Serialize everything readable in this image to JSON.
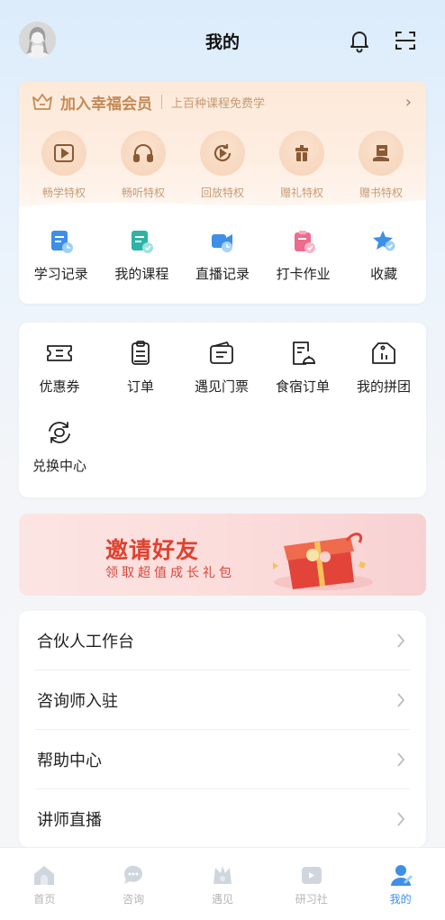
{
  "header": {
    "title": "我的",
    "bell_icon": "bell-icon",
    "scan_icon": "scan-icon"
  },
  "vip": {
    "title": "加入幸福会员",
    "subtitle": "上百种课程免费学",
    "arrow": "›",
    "perks": [
      {
        "label": "畅学特权",
        "icon": "play-icon"
      },
      {
        "label": "畅听特权",
        "icon": "headphones-icon"
      },
      {
        "label": "回放特权",
        "icon": "replay-icon"
      },
      {
        "label": "赠礼特权",
        "icon": "gift-icon"
      },
      {
        "label": "赠书特权",
        "icon": "book-icon"
      }
    ],
    "colors": {
      "gold": "#c48a56",
      "bg": "#fde9d8"
    }
  },
  "shortcuts": [
    {
      "label": "学习记录",
      "icon": "study-record-icon"
    },
    {
      "label": "我的课程",
      "icon": "my-courses-icon"
    },
    {
      "label": "直播记录",
      "icon": "live-record-icon"
    },
    {
      "label": "打卡作业",
      "icon": "checkin-homework-icon"
    },
    {
      "label": "收藏",
      "icon": "favorite-star-icon"
    }
  ],
  "orders": [
    {
      "label": "优惠券",
      "icon": "coupon-icon"
    },
    {
      "label": "订单",
      "icon": "order-icon"
    },
    {
      "label": "遇见门票",
      "icon": "ticket-icon"
    },
    {
      "label": "食宿订单",
      "icon": "lodging-order-icon"
    },
    {
      "label": "我的拼团",
      "icon": "group-buy-icon"
    },
    {
      "label": "兑换中心",
      "icon": "exchange-icon"
    }
  ],
  "banner": {
    "title": "邀请好友",
    "subtitle": "领取超值成长礼包"
  },
  "menu": [
    {
      "label": "合伙人工作台"
    },
    {
      "label": "咨询师入驻"
    },
    {
      "label": "帮助中心"
    },
    {
      "label": "讲师直播"
    }
  ],
  "tabs": [
    {
      "label": "首页",
      "icon": "home-icon"
    },
    {
      "label": "咨询",
      "icon": "consult-icon"
    },
    {
      "label": "遇见",
      "icon": "meet-icon"
    },
    {
      "label": "研习社",
      "icon": "study-club-icon"
    },
    {
      "label": "我的",
      "icon": "profile-icon",
      "active": true
    }
  ],
  "colors": {
    "accent": "#3d8fe8",
    "banner_red": "#e0412f"
  }
}
